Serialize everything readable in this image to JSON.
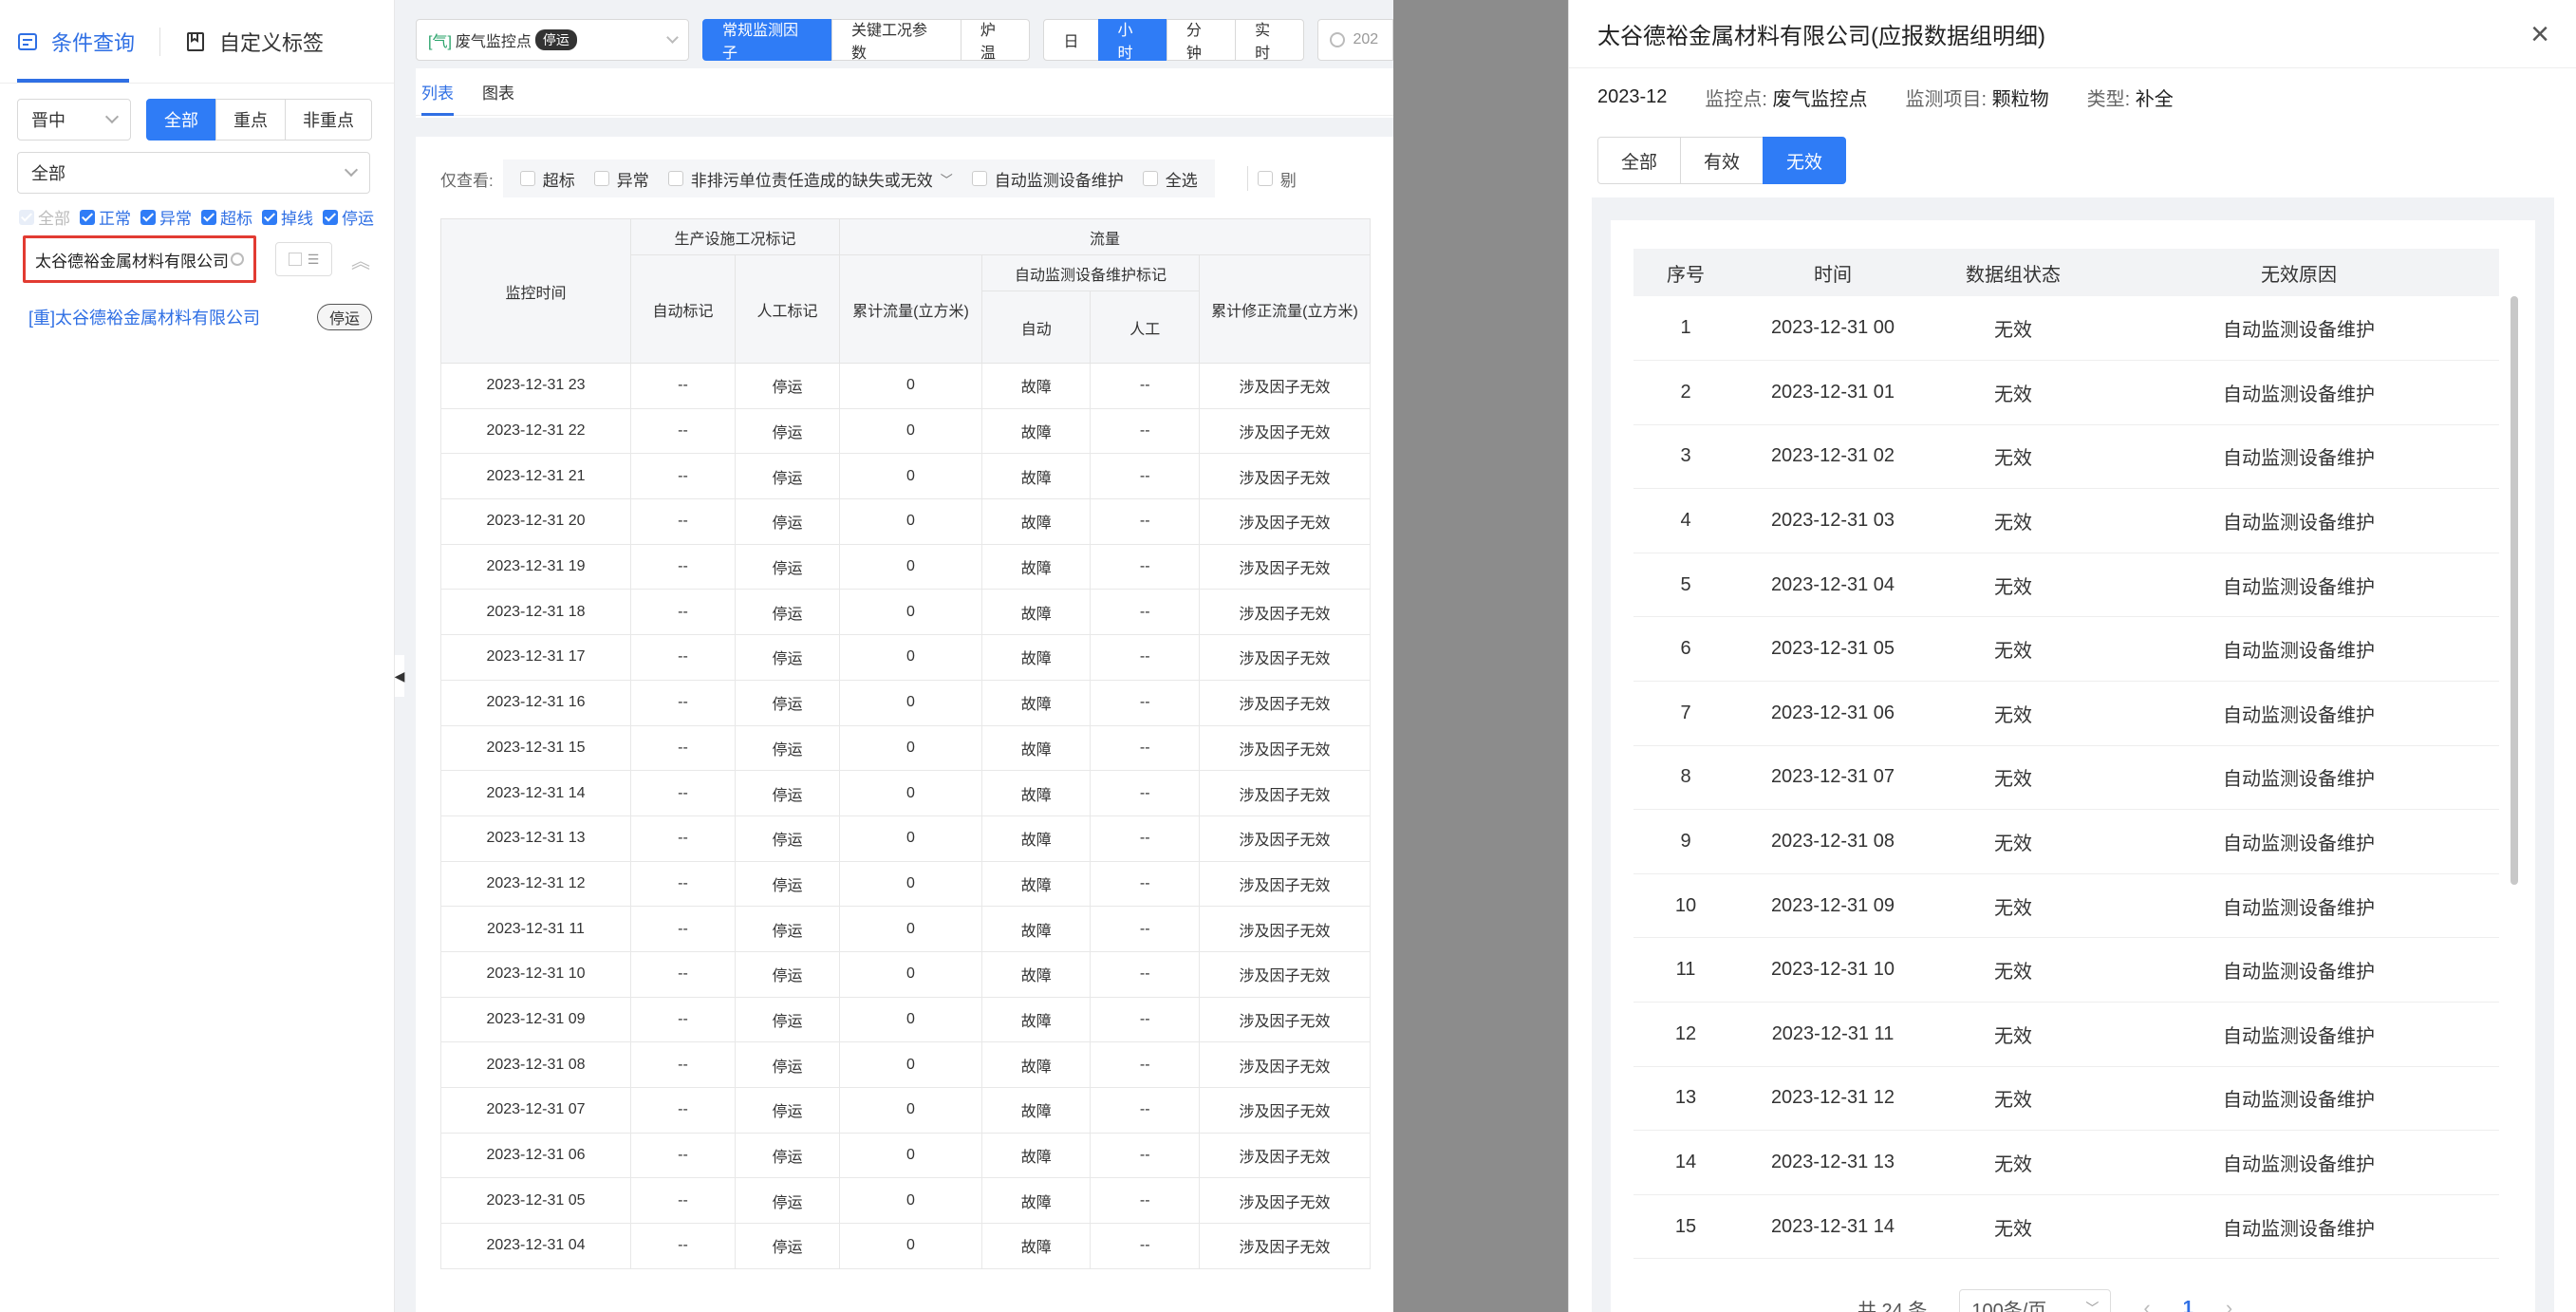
{
  "sidebar": {
    "tabs": [
      {
        "label": "条件查询",
        "active": true
      },
      {
        "label": "自定义标签",
        "active": false
      }
    ],
    "region": "晋中",
    "scope_buttons": [
      "全部",
      "重点",
      "非重点"
    ],
    "scope_active": "全部",
    "type_select": "全部",
    "status_checks": [
      "全部",
      "正常",
      "异常",
      "超标",
      "掉线",
      "停运"
    ],
    "search_value": "太谷德裕金属材料有限公司",
    "company_item": "[重]太谷德裕金属材料有限公司",
    "company_tag": "停运"
  },
  "toolbar": {
    "point_prefix": "[气]",
    "point_name": "废气监控点",
    "point_badge": "停运",
    "param_tabs": [
      "常规监测因子",
      "关键工况参数",
      "炉温"
    ],
    "param_active": "常规监测因子",
    "time_tabs": [
      "日",
      "小时",
      "分钟",
      "实时"
    ],
    "time_active": "小时",
    "date_prefix": "202"
  },
  "view_tabs": [
    "列表",
    "图表"
  ],
  "filter": {
    "label": "仅查看:",
    "options": [
      "超标",
      "异常",
      "非排污单位责任造成的缺失或无效",
      "自动监测设备维护",
      "全选"
    ],
    "extra": "剔"
  },
  "main_table": {
    "group_headers": [
      "生产设施工况标记",
      "流量",
      "自动监测设备维护标记"
    ],
    "headers": [
      "监控时间",
      "自动标记",
      "人工标记",
      "累计流量(立方米)",
      "自动",
      "人工",
      "累计修正流量(立方米)"
    ],
    "rows": [
      [
        "2023-12-31 23",
        "--",
        "停运",
        "0",
        "故障",
        "--",
        "涉及因子无效"
      ],
      [
        "2023-12-31 22",
        "--",
        "停运",
        "0",
        "故障",
        "--",
        "涉及因子无效"
      ],
      [
        "2023-12-31 21",
        "--",
        "停运",
        "0",
        "故障",
        "--",
        "涉及因子无效"
      ],
      [
        "2023-12-31 20",
        "--",
        "停运",
        "0",
        "故障",
        "--",
        "涉及因子无效"
      ],
      [
        "2023-12-31 19",
        "--",
        "停运",
        "0",
        "故障",
        "--",
        "涉及因子无效"
      ],
      [
        "2023-12-31 18",
        "--",
        "停运",
        "0",
        "故障",
        "--",
        "涉及因子无效"
      ],
      [
        "2023-12-31 17",
        "--",
        "停运",
        "0",
        "故障",
        "--",
        "涉及因子无效"
      ],
      [
        "2023-12-31 16",
        "--",
        "停运",
        "0",
        "故障",
        "--",
        "涉及因子无效"
      ],
      [
        "2023-12-31 15",
        "--",
        "停运",
        "0",
        "故障",
        "--",
        "涉及因子无效"
      ],
      [
        "2023-12-31 14",
        "--",
        "停运",
        "0",
        "故障",
        "--",
        "涉及因子无效"
      ],
      [
        "2023-12-31 13",
        "--",
        "停运",
        "0",
        "故障",
        "--",
        "涉及因子无效"
      ],
      [
        "2023-12-31 12",
        "--",
        "停运",
        "0",
        "故障",
        "--",
        "涉及因子无效"
      ],
      [
        "2023-12-31 11",
        "--",
        "停运",
        "0",
        "故障",
        "--",
        "涉及因子无效"
      ],
      [
        "2023-12-31 10",
        "--",
        "停运",
        "0",
        "故障",
        "--",
        "涉及因子无效"
      ],
      [
        "2023-12-31 09",
        "--",
        "停运",
        "0",
        "故障",
        "--",
        "涉及因子无效"
      ],
      [
        "2023-12-31 08",
        "--",
        "停运",
        "0",
        "故障",
        "--",
        "涉及因子无效"
      ],
      [
        "2023-12-31 07",
        "--",
        "停运",
        "0",
        "故障",
        "--",
        "涉及因子无效"
      ],
      [
        "2023-12-31 06",
        "--",
        "停运",
        "0",
        "故障",
        "--",
        "涉及因子无效"
      ],
      [
        "2023-12-31 05",
        "--",
        "停运",
        "0",
        "故障",
        "--",
        "涉及因子无效"
      ],
      [
        "2023-12-31 04",
        "--",
        "停运",
        "0",
        "故障",
        "--",
        "涉及因子无效"
      ]
    ]
  },
  "drawer": {
    "title": "太谷德裕金属材料有限公司(应报数据组明细)",
    "period": "2023-12",
    "point_key": "监控点:",
    "point_val": "废气监控点",
    "item_key": "监测项目:",
    "item_val": "颗粒物",
    "type_key": "类型:",
    "type_val": "补全",
    "tabs": [
      "全部",
      "有效",
      "无效"
    ],
    "tab_active": "无效",
    "headers": [
      "序号",
      "时间",
      "数据组状态",
      "无效原因"
    ],
    "rows": [
      [
        "1",
        "2023-12-31 00",
        "无效",
        "自动监测设备维护"
      ],
      [
        "2",
        "2023-12-31 01",
        "无效",
        "自动监测设备维护"
      ],
      [
        "3",
        "2023-12-31 02",
        "无效",
        "自动监测设备维护"
      ],
      [
        "4",
        "2023-12-31 03",
        "无效",
        "自动监测设备维护"
      ],
      [
        "5",
        "2023-12-31 04",
        "无效",
        "自动监测设备维护"
      ],
      [
        "6",
        "2023-12-31 05",
        "无效",
        "自动监测设备维护"
      ],
      [
        "7",
        "2023-12-31 06",
        "无效",
        "自动监测设备维护"
      ],
      [
        "8",
        "2023-12-31 07",
        "无效",
        "自动监测设备维护"
      ],
      [
        "9",
        "2023-12-31 08",
        "无效",
        "自动监测设备维护"
      ],
      [
        "10",
        "2023-12-31 09",
        "无效",
        "自动监测设备维护"
      ],
      [
        "11",
        "2023-12-31 10",
        "无效",
        "自动监测设备维护"
      ],
      [
        "12",
        "2023-12-31 11",
        "无效",
        "自动监测设备维护"
      ],
      [
        "13",
        "2023-12-31 12",
        "无效",
        "自动监测设备维护"
      ],
      [
        "14",
        "2023-12-31 13",
        "无效",
        "自动监测设备维护"
      ],
      [
        "15",
        "2023-12-31 14",
        "无效",
        "自动监测设备维护"
      ]
    ],
    "pager": {
      "total": "共 24 条",
      "page_size": "100条/页",
      "current": "1"
    }
  },
  "colors": {
    "accent": "#2f7cf6",
    "danger": "#e23b32",
    "mask": "#8c8c8c"
  }
}
